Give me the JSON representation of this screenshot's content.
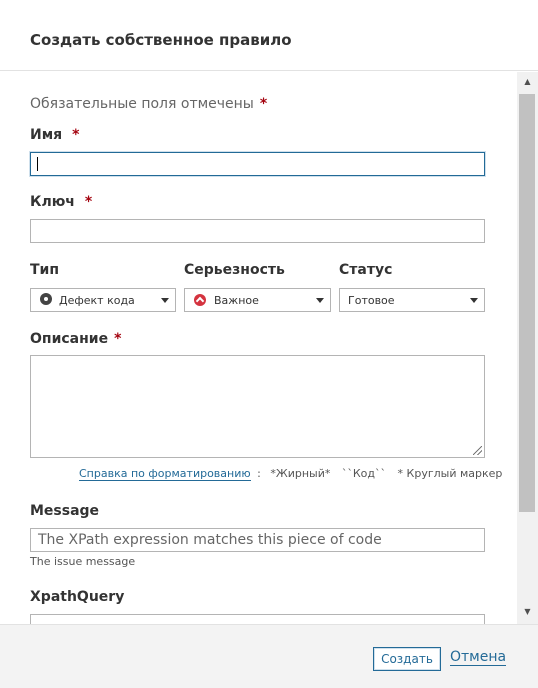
{
  "dialog": {
    "title": "Создать собственное правило"
  },
  "form": {
    "required_note": "Обязательные поля отмечены",
    "required_mark": "*",
    "name": {
      "label": "Имя",
      "value": ""
    },
    "key": {
      "label": "Ключ",
      "value": ""
    },
    "type": {
      "label": "Тип",
      "value": "Дефект кода",
      "icon": "bug-icon"
    },
    "severity": {
      "label": "Серьезность",
      "value": "Важное",
      "icon": "major-severity-icon"
    },
    "status": {
      "label": "Статус",
      "value": "Готовое"
    },
    "description": {
      "label": "Описание",
      "value": ""
    },
    "formatting": {
      "link": "Справка по форматированию",
      "separator": ":",
      "bold": "*Жирный*",
      "code": "``Код``",
      "bullet": "* Круглый маркер"
    },
    "message": {
      "label": "Message",
      "placeholder": "The XPath expression matches this piece of code",
      "help": "The issue message"
    },
    "xpath": {
      "label": "XpathQuery",
      "value": ""
    }
  },
  "footer": {
    "create_label": "Создать",
    "cancel_label": "Отмена"
  },
  "colors": {
    "accent": "#236a97",
    "required": "#a4030f",
    "major": "#d4333f"
  }
}
